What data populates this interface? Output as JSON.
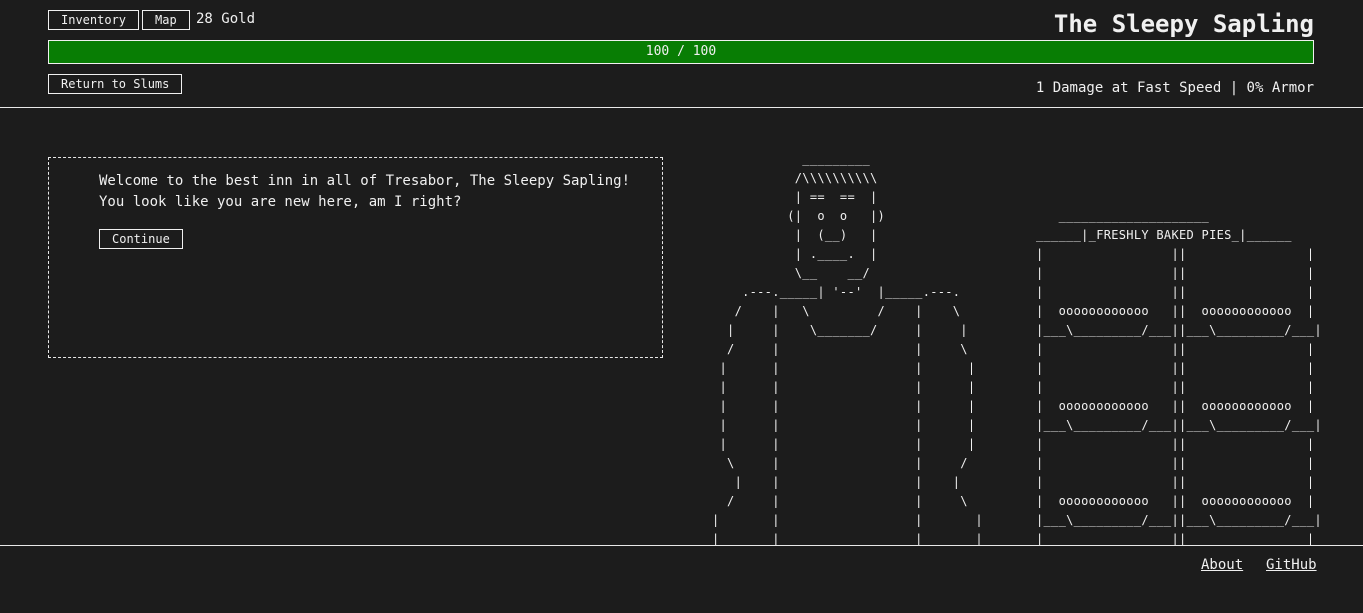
{
  "header": {
    "inventory_label": "Inventory",
    "map_label": "Map",
    "gold": "28 Gold",
    "title": "The Sleepy Sapling",
    "hp": {
      "text": "100 / 100",
      "current": 100,
      "max": 100,
      "color": "#087d04"
    },
    "return_label": "Return to Slums",
    "stats": "1 Damage at Fast Speed | 0% Armor"
  },
  "dialog": {
    "line1": "Welcome to the best inn in all of Tresabor, The Sleepy Sapling!",
    "line2": "You look like you are new here, am I right?",
    "continue_label": "Continue"
  },
  "scene": {
    "innkeeper_art": "            _________\n           /\\\\\\\\\\\\\\\\\\\\\n           | ==  ==  |\n          (|  o  o   |)\n           |  (__)   |\n           | .____.  |\n           \\__    __/\n    .---._____| '--'  |_____.---.\n   /    |   \\         /    |    \\\n  |     |    \\_______/     |     |\n  /     |                  |     \\\n |      |                  |      |\n |      |                  |      |\n |      |                  |      |\n |      |                  |      |\n |      |                  |      |\n  \\     |                  |     /\n   |    |                  |    |\n  /     |                  |     \\\n|       |                  |       |\n|       |                  |       |",
    "pie_shelf_art": "   ____________________\n______|_FRESHLY BAKED PIES_|______\n|                 ||                |\n|                 ||                |\n|                 ||                |\n|  oooooooooooo   ||  oooooooooooo  |\n|___\\_________/___||___\\_________/___|\n|                 ||                |\n|                 ||                |\n|                 ||                |\n|  oooooooooooo   ||  oooooooooooo  |\n|___\\_________/___||___\\_________/___|\n|                 ||                |\n|                 ||                |\n|                 ||                |\n|  oooooooooooo   ||  oooooooooooo  |\n|___\\_________/___||___\\_________/___|\n|                 ||                |"
  },
  "footer": {
    "about_label": "About",
    "github_label": "GitHub"
  }
}
